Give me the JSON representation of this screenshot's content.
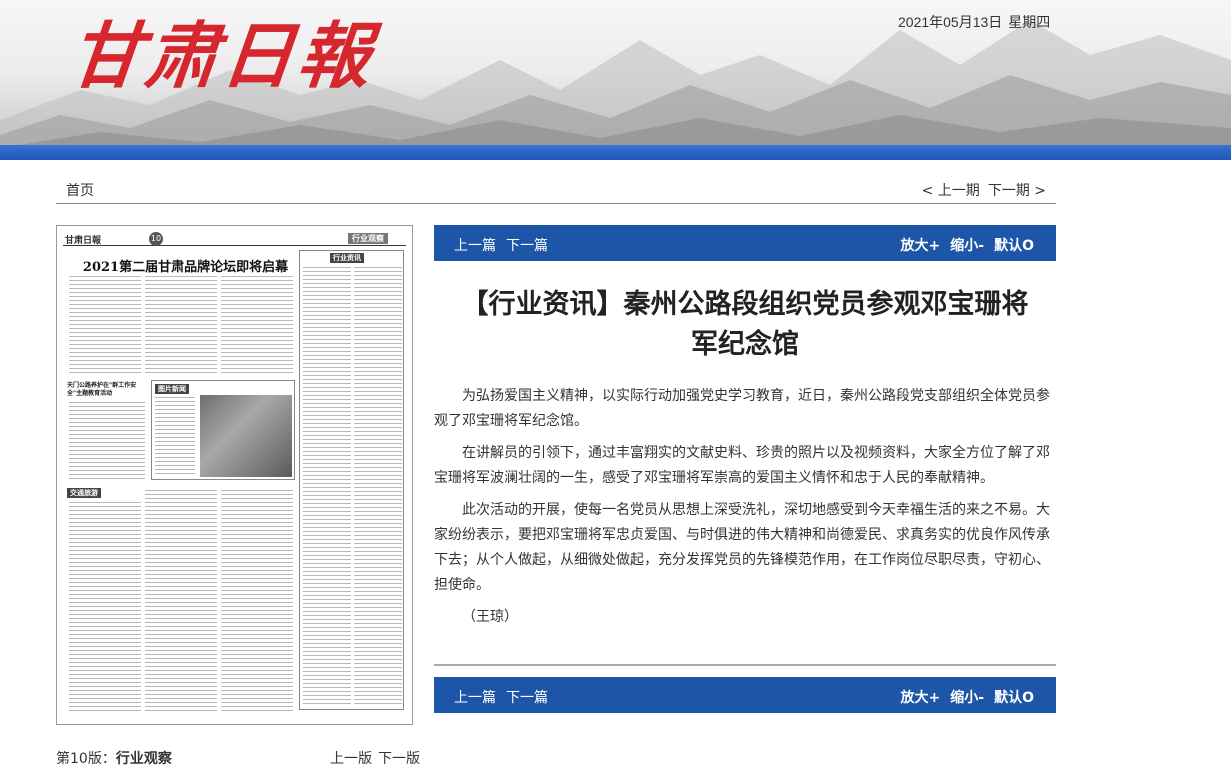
{
  "header": {
    "logo_text": "甘肃日報",
    "date": "2021年05月13日",
    "weekday": "星期四"
  },
  "nav": {
    "home": "首页",
    "prev_edition": "< 上一期",
    "next_edition": "下一期 >"
  },
  "paper": {
    "masthead_logo": "甘肃日報",
    "page_number": "10",
    "section_tag": "行业观察",
    "headline": "2021第二届甘肃品牌论坛即将启幕",
    "sub_heads": [
      "行业资讯",
      "天门公路养护在\"群工作安全\"主题教育活动"
    ],
    "photo_label": "图片新闻",
    "block_label": "交通旅游"
  },
  "edition": {
    "page_label": "第10版：",
    "page_name": "行业观察",
    "prev_page": "上一版",
    "next_page": "下一版"
  },
  "toolbar": {
    "prev_article": "上一篇",
    "next_article": "下一篇",
    "zoom_in": "放大+",
    "zoom_out": "缩小-",
    "reset": "默认O"
  },
  "article": {
    "title": "【行业资讯】秦州公路段组织党员参观邓宝珊将军纪念馆",
    "paragraphs": [
      "为弘扬爱国主义精神，以实际行动加强党史学习教育，近日，秦州公路段党支部组织全体党员参观了邓宝珊将军纪念馆。",
      "在讲解员的引领下，通过丰富翔实的文献史料、珍贵的照片以及视频资料，大家全方位了解了邓宝珊将军波澜壮阔的一生，感受了邓宝珊将军崇高的爱国主义情怀和忠于人民的奉献精神。",
      "此次活动的开展，使每一名党员从思想上深受洗礼，深切地感受到今天幸福生活的来之不易。大家纷纷表示，要把邓宝珊将军忠贞爱国、与时俱进的伟大精神和尚德爱民、求真务实的优良作风传承下去；从个人做起，从细微处做起，充分发挥党员的先锋模范作用，在工作岗位尽职尽责，守初心、担使命。"
    ],
    "author": "（王琼）"
  }
}
